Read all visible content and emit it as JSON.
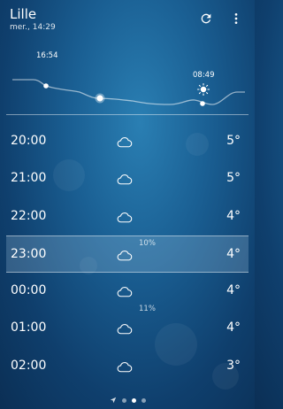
{
  "header": {
    "city": "Lille",
    "updated": "mer., 14:29"
  },
  "icons": {
    "refresh": "refresh-icon",
    "menu": "more-vert-icon"
  },
  "sun": {
    "sunset": "16:54",
    "sunrise": "08:49"
  },
  "hours": [
    {
      "time": "20:00",
      "icon": "cloud-icon",
      "temp": "5°",
      "precip": ""
    },
    {
      "time": "21:00",
      "icon": "cloud-icon",
      "temp": "5°",
      "precip": ""
    },
    {
      "time": "22:00",
      "icon": "cloud-icon",
      "temp": "4°",
      "precip": ""
    },
    {
      "time": "23:00",
      "icon": "cloud-icon",
      "temp": "4°",
      "precip": "10%",
      "selected": true
    },
    {
      "time": "00:00",
      "icon": "cloud-icon",
      "temp": "4°",
      "precip": ""
    },
    {
      "time": "01:00",
      "icon": "cloud-icon",
      "temp": "4°",
      "precip": "11%"
    },
    {
      "time": "02:00",
      "icon": "cloud-icon",
      "temp": "3°",
      "precip": ""
    }
  ],
  "pager": {
    "pages": 3,
    "active": 2
  },
  "colors": {
    "background": "#1a5f93",
    "accent": "#ffffff"
  }
}
